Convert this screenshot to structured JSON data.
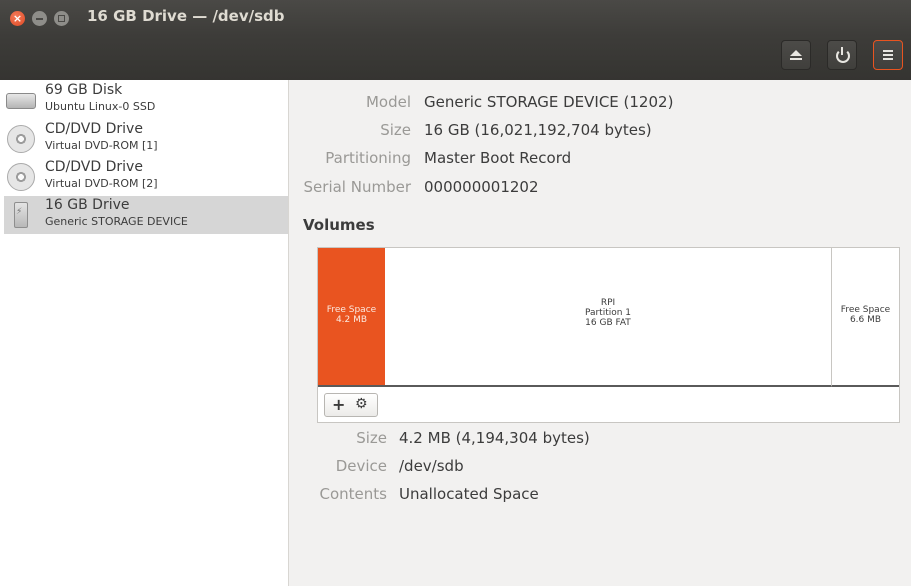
{
  "window": {
    "title": "16 GB Drive — /dev/sdb"
  },
  "header_buttons": {
    "eject": "eject-icon",
    "power": "power-icon",
    "menu": "menu-icon"
  },
  "sidebar": {
    "devices": [
      {
        "name": "69 GB Disk",
        "sub": "Ubuntu Linux-0 SSD",
        "icon": "hard-disk-icon"
      },
      {
        "name": "CD/DVD Drive",
        "sub": "Virtual DVD-ROM [1]",
        "icon": "optical-disc-icon"
      },
      {
        "name": "CD/DVD Drive",
        "sub": "Virtual DVD-ROM [2]",
        "icon": "optical-disc-icon"
      },
      {
        "name": "16 GB Drive",
        "sub": "Generic STORAGE DEVICE",
        "icon": "usb-drive-icon",
        "selected": true
      }
    ]
  },
  "drive": {
    "model_label": "Model",
    "model": "Generic STORAGE DEVICE (1202)",
    "size_label": "Size",
    "size": "16 GB (16,021,192,704 bytes)",
    "partitioning_label": "Partitioning",
    "partitioning": "Master Boot Record",
    "serial_label": "Serial Number",
    "serial": "000000001202"
  },
  "volumes": {
    "heading": "Volumes",
    "segments": [
      {
        "line1": "Free Space",
        "line2": "4.2 MB",
        "line3": ""
      },
      {
        "line1": "RPI",
        "line2": "Partition 1",
        "line3": "16 GB FAT"
      },
      {
        "line1": "Free Space",
        "line2": "6.6 MB",
        "line3": ""
      }
    ],
    "toolbar": {
      "add": "+",
      "settings": "gears-icon"
    }
  },
  "selected_volume": {
    "size_label": "Size",
    "size": "4.2 MB (4,194,304 bytes)",
    "device_label": "Device",
    "device": "/dev/sdb",
    "contents_label": "Contents",
    "contents": "Unallocated Space"
  },
  "colors": {
    "accent": "#e95420",
    "titlebar": "#3d3c39"
  }
}
